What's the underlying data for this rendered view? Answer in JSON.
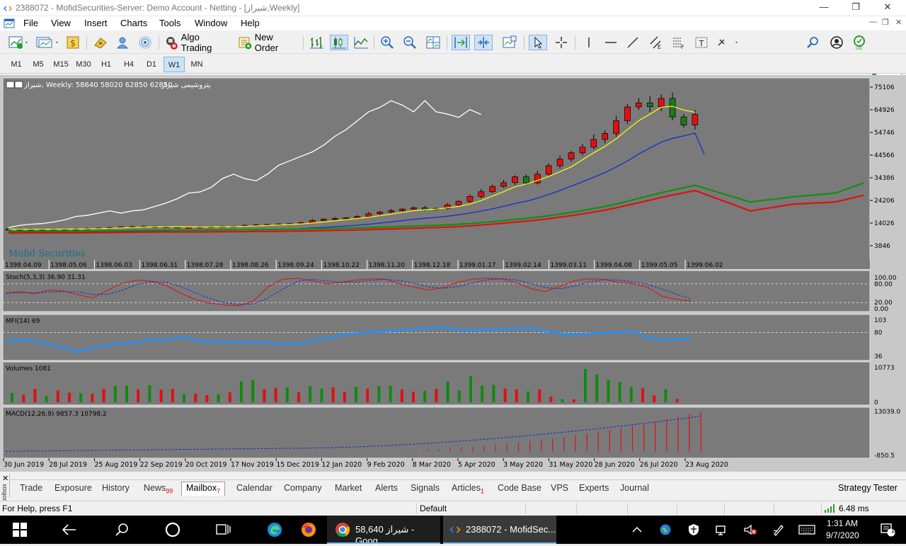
{
  "window": {
    "title": "2388072 - MofidSecurities-Server: Demo Account - Netting - [شیراز,Weekly]"
  },
  "menu": [
    "File",
    "View",
    "Insert",
    "Charts",
    "Tools",
    "Window",
    "Help"
  ],
  "toolbar": {
    "algo_trading": "Algo Trading",
    "new_order": "New Order"
  },
  "timeframes": [
    "M1",
    "M5",
    "M15",
    "M30",
    "H1",
    "H4",
    "D1",
    "W1",
    "MN"
  ],
  "active_timeframe": "W1",
  "chart": {
    "header": "شیراز, Weekly:  58640 58020 62850 62850",
    "header_name": "پتروشیمی شیراز",
    "watermark": "Mofid Securities",
    "price_labels": [
      "75106",
      "64926",
      "54746",
      "44566",
      "34386",
      "24206",
      "14026",
      "3846"
    ],
    "shamsi_dates": [
      "1398.04.09",
      "1398.05.06",
      "1398.06.03",
      "1398.06.31",
      "1398.07.28",
      "1398.08.26",
      "1398.09.24",
      "1398.10.22",
      "1398.11.20",
      "1398.12.18",
      "1399.01.17",
      "1399.02.14",
      "1399.03.11",
      "1399.04.08",
      "1399.05.05",
      "1399.06.02"
    ],
    "time_labels": [
      "30 Jun 2019",
      "28 Jul 2019",
      "25 Aug 2019",
      "22 Sep 2019",
      "20 Oct 2019",
      "17 Nov 2019",
      "15 Dec 2019",
      "12 Jan 2020",
      "9 Feb 2020",
      "8 Mar 2020",
      "5 Apr 2020",
      "3 May 2020",
      "31 May 2020",
      "28 Jun 2020",
      "26 Jul 2020",
      "23 Aug 2020"
    ],
    "stoch": {
      "label": "Stoch(5,3,3) 36.90 31.31",
      "levels": [
        "100.00",
        "80.00",
        "20.00",
        "0.00"
      ]
    },
    "mfi": {
      "label": "MFI(14) 69",
      "levels": [
        "103",
        "80",
        "36"
      ]
    },
    "volumes": {
      "label": "Volumes 1081",
      "levels": [
        "10773",
        "0"
      ]
    },
    "macd": {
      "label": "MACD(12,26,9) 9857.3 10798.2",
      "levels": [
        "13039.0",
        "-850.5"
      ]
    }
  },
  "bottom_tabs": [
    {
      "label": "Trade",
      "badge": ""
    },
    {
      "label": "Exposure",
      "badge": ""
    },
    {
      "label": "History",
      "badge": ""
    },
    {
      "label": "News",
      "badge": "99"
    },
    {
      "label": "Mailbox",
      "badge": "7"
    },
    {
      "label": "Calendar",
      "badge": ""
    },
    {
      "label": "Company",
      "badge": ""
    },
    {
      "label": "Market",
      "badge": ""
    },
    {
      "label": "Alerts",
      "badge": ""
    },
    {
      "label": "Signals",
      "badge": ""
    },
    {
      "label": "Articles",
      "badge": "1"
    },
    {
      "label": "Code Base",
      "badge": ""
    },
    {
      "label": "VPS",
      "badge": ""
    },
    {
      "label": "Experts",
      "badge": ""
    },
    {
      "label": "Journal",
      "badge": ""
    }
  ],
  "active_tab": "Mailbox",
  "strategy_tester": "Strategy Tester",
  "toolbox_label": "Toolbox",
  "status": {
    "help": "For Help, press F1",
    "profile": "Default",
    "ping": "6.48 ms"
  },
  "taskbar": {
    "chrome_app": "شیراز 58,640 - Goog...",
    "mt5_app": "2388072 - MofidSec...",
    "time": "1:31 AM",
    "date": "9/7/2020",
    "notifications": "16"
  },
  "chart_data": {
    "type": "candlestick",
    "price_range": [
      3846,
      75106
    ],
    "candles": [
      {
        "date": "30 Jun 2019",
        "dir": "down"
      }
    ],
    "candle_closes": [
      11200,
      11250,
      11300,
      11300,
      11350,
      11400,
      11500,
      11600,
      11800,
      12000,
      12300,
      12400,
      12500,
      12400,
      12300,
      12200,
      12200,
      12300,
      12400,
      12500,
      12600,
      13000,
      13200,
      13400,
      13500,
      13800,
      14200,
      15200,
      15800,
      16100,
      16400,
      17000,
      18200,
      19000,
      19600,
      20300,
      20900,
      20200,
      20600,
      22200,
      23800,
      26000,
      28100,
      30500,
      32200,
      34800,
      32100,
      36000,
      39800,
      42800,
      45600,
      48100,
      51600,
      54300,
      60000,
      66200,
      68000,
      66300,
      70000,
      61700,
      58100,
      62850
    ],
    "sma_white": "top-left line from ~12000 rising to ~69000 then falling to ~60000 (ends mid-2020)",
    "volumes_peak": 10773,
    "stoch_last": [
      36.9,
      31.31
    ],
    "mfi_last": 69,
    "macd_last": [
      9857.3,
      10798.2
    ]
  }
}
